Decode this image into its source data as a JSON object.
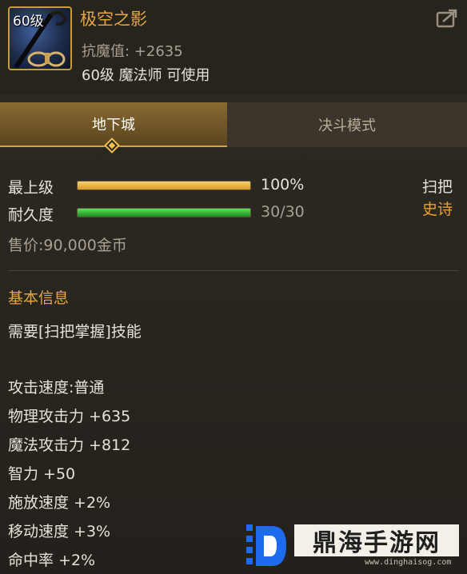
{
  "item": {
    "level_badge": "60级",
    "name": "极空之影",
    "resist_label": "抗魔值:",
    "resist_value": "+2635",
    "requirement": "60级 魔法师 可使用"
  },
  "tabs": [
    {
      "label": "地下城",
      "active": true
    },
    {
      "label": "决斗模式",
      "active": false
    }
  ],
  "stats": {
    "grade_label": "最上级",
    "grade_percent": 100,
    "grade_text": "100%",
    "durability_label": "耐久度",
    "durability_current": 30,
    "durability_max": 30,
    "durability_text": "30/30",
    "type_label": "扫把",
    "rarity_label": "史诗",
    "price": "售价:90,000金币"
  },
  "info": {
    "section_title": "基本信息",
    "skill_req": "需要[扫把掌握]技能",
    "lines": [
      "攻击速度:普通",
      "物理攻击力 +635",
      "魔法攻击力 +812",
      "智力 +50",
      "施放速度 +2%",
      "移动速度 +3%",
      "命中率 +2%"
    ]
  },
  "watermark": {
    "text": "鼎海手游网",
    "url": "www.dinghaisog.com"
  },
  "colors": {
    "title": "#e5a646",
    "grade_bar": "#e8b23a",
    "durability_bar": "#2fb52a",
    "rarity": "#e8a030",
    "section": "#e5a646"
  },
  "icons": [
    "share-icon",
    "staff-weapon-icon",
    "watermark-logo-icon"
  ]
}
